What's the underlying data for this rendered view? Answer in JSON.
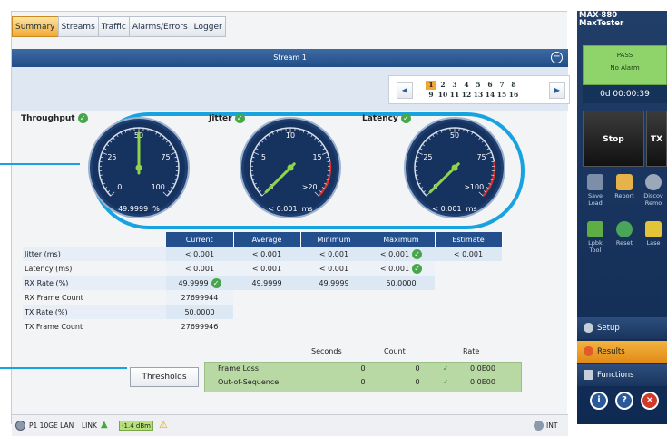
{
  "tabs": [
    "Summary",
    "Streams",
    "Traffic",
    "Alarms/Errors",
    "Logger"
  ],
  "stream_header": "Stream 1",
  "pager": {
    "row1": [
      "1",
      "2",
      "3",
      "4",
      "5",
      "6",
      "7",
      "8"
    ],
    "row2": [
      "9",
      "10",
      "11",
      "12",
      "13",
      "14",
      "15",
      "16"
    ],
    "selected": "1"
  },
  "gauges": {
    "throughput": {
      "label": "Throughput",
      "ticks": [
        "0",
        "25",
        "50",
        "75",
        "100"
      ],
      "readout": "49.9999",
      "unit": "%",
      "value_fraction": 0.5
    },
    "jitter": {
      "label": "Jitter",
      "ticks": [
        "0",
        "5",
        "10",
        "15",
        ">20"
      ],
      "readout": "< 0.001",
      "unit": "ms",
      "value_fraction": 0.0
    },
    "latency": {
      "label": "Latency",
      "ticks": [
        "0",
        "25",
        "50",
        "75",
        ">100"
      ],
      "readout": "< 0.001",
      "unit": "ms",
      "value_fraction": 0.0
    }
  },
  "table": {
    "headers": [
      "Current",
      "Average",
      "Minimum",
      "Maximum",
      "Estimate"
    ],
    "rows": [
      {
        "label": "Jitter (ms)",
        "cells": [
          "< 0.001",
          "< 0.001",
          "< 0.001",
          "< 0.001",
          "< 0.001"
        ]
      },
      {
        "label": "Latency (ms)",
        "cells": [
          "< 0.001",
          "< 0.001",
          "< 0.001",
          "< 0.001",
          ""
        ]
      },
      {
        "label": "RX Rate (%)",
        "cells": [
          "49.9999",
          "49.9999",
          "49.9999",
          "50.0000",
          ""
        ]
      },
      {
        "label": "RX Frame Count",
        "cells": [
          "27699944"
        ]
      },
      {
        "label": "TX Rate (%)",
        "cells": [
          "50.0000"
        ]
      },
      {
        "label": "TX Frame Count",
        "cells": [
          "27699946"
        ]
      }
    ]
  },
  "thresholds": {
    "button": "Thresholds",
    "headers": [
      "Seconds",
      "Count",
      "Rate"
    ],
    "rows": [
      {
        "label": "Frame Loss",
        "seconds": "0",
        "count": "0",
        "rate": "0.0E00"
      },
      {
        "label": "Out-of-Sequence",
        "seconds": "0",
        "count": "0",
        "rate": "0.0E00"
      }
    ]
  },
  "status_bar": {
    "port": "P1 10GE LAN",
    "link": "LINK",
    "power": "-1.4 dBm",
    "clock": "INT"
  },
  "sidebar": {
    "model": "MAX-880",
    "product": "MaxTester",
    "pass": "PASS",
    "alarm": "No Alarm",
    "timer": "0d 00:00:39",
    "stop": "Stop",
    "tx": "TX",
    "tools_row1": [
      {
        "label": "Save\nLoad"
      },
      {
        "label": "Report"
      },
      {
        "label": "Discov\nRemo"
      }
    ],
    "tools_row2": [
      {
        "label": "Lpbk\nTool"
      },
      {
        "label": "Reset"
      },
      {
        "label": "Lase"
      }
    ],
    "menu": [
      "Setup",
      "Results",
      "Functions"
    ]
  },
  "colors": {
    "accent": "#17a3e0",
    "pass_green": "#8fd36b",
    "tab_active": "#f2a935",
    "header_blue": "#234f8c"
  }
}
